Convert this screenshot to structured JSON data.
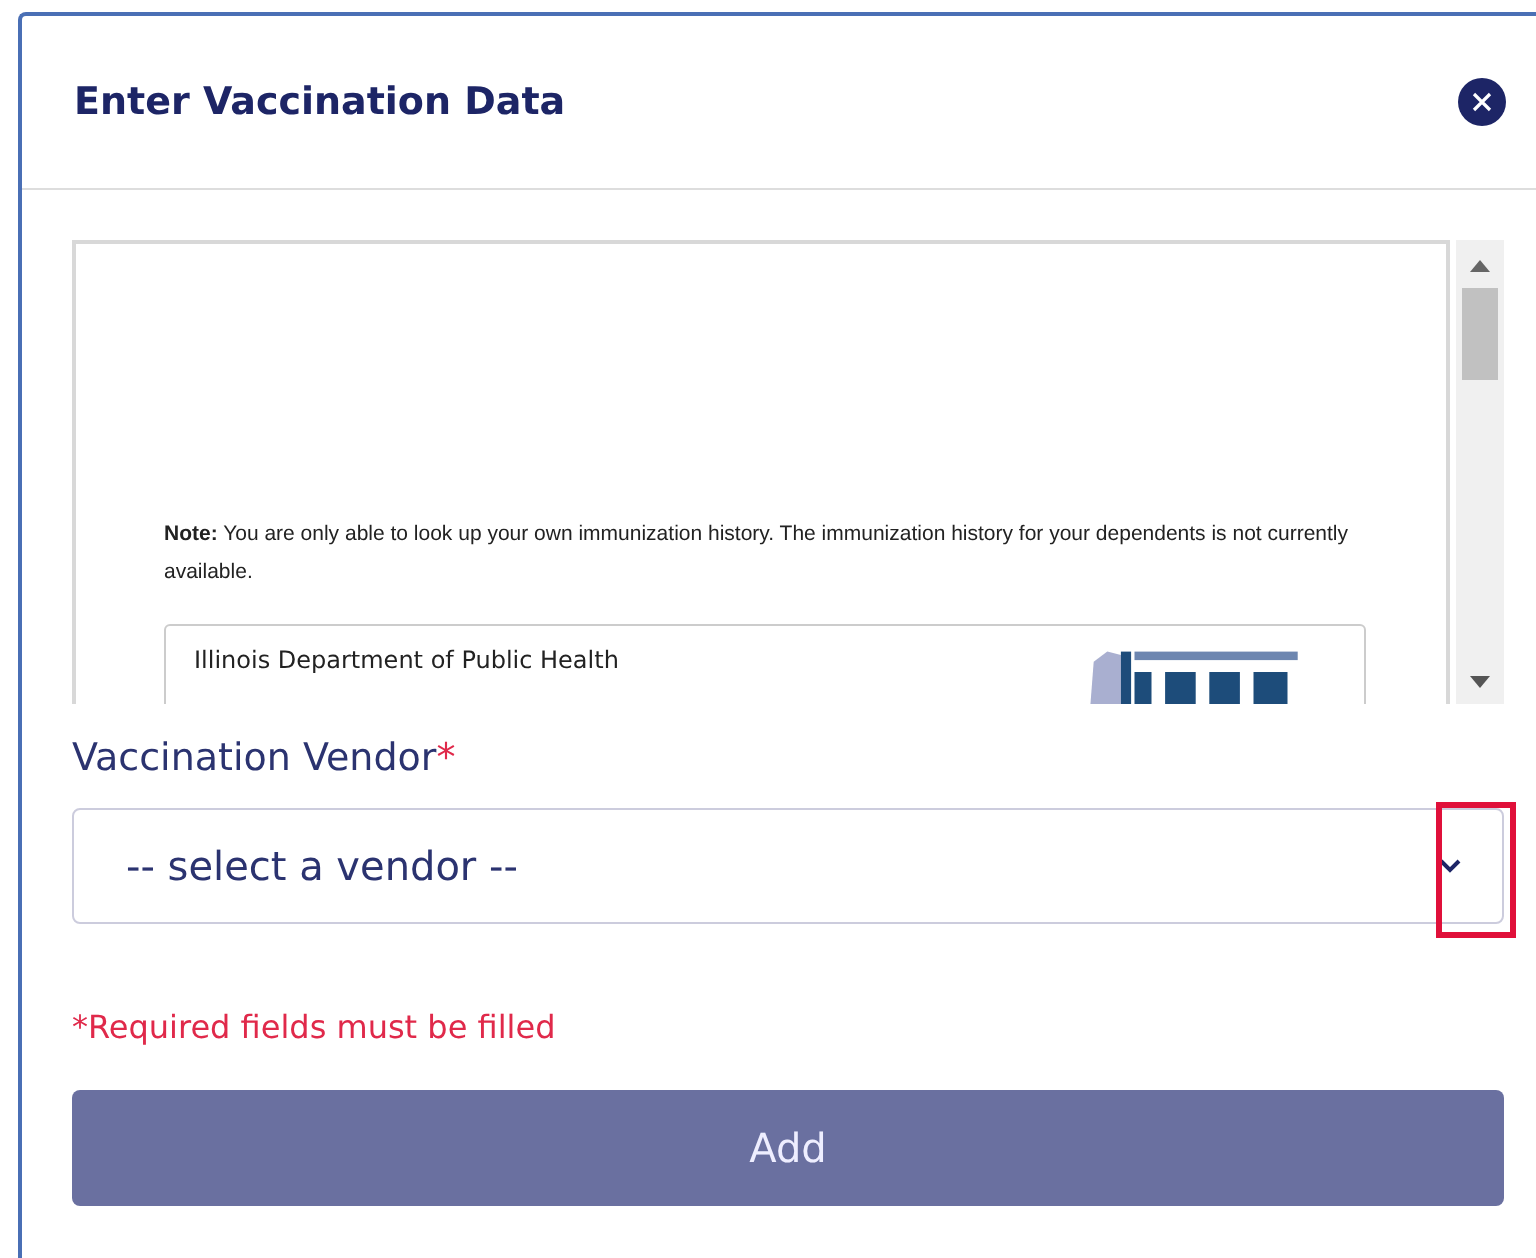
{
  "dialog": {
    "title": "Enter Vaccination Data"
  },
  "document": {
    "note": "**Note:** You are only able to look up your own immunization history.  The immunization history for your dependents is not currently available.",
    "card_title": "Illinois Department of Public Health"
  },
  "vendor_field": {
    "label": "Vaccination Vendor",
    "required_mark": "*",
    "placeholder": "-- select a vendor --",
    "highlighted": true
  },
  "required_message": "*Required fields must be filled",
  "add_button": {
    "label": "Add",
    "disabled": true
  }
}
